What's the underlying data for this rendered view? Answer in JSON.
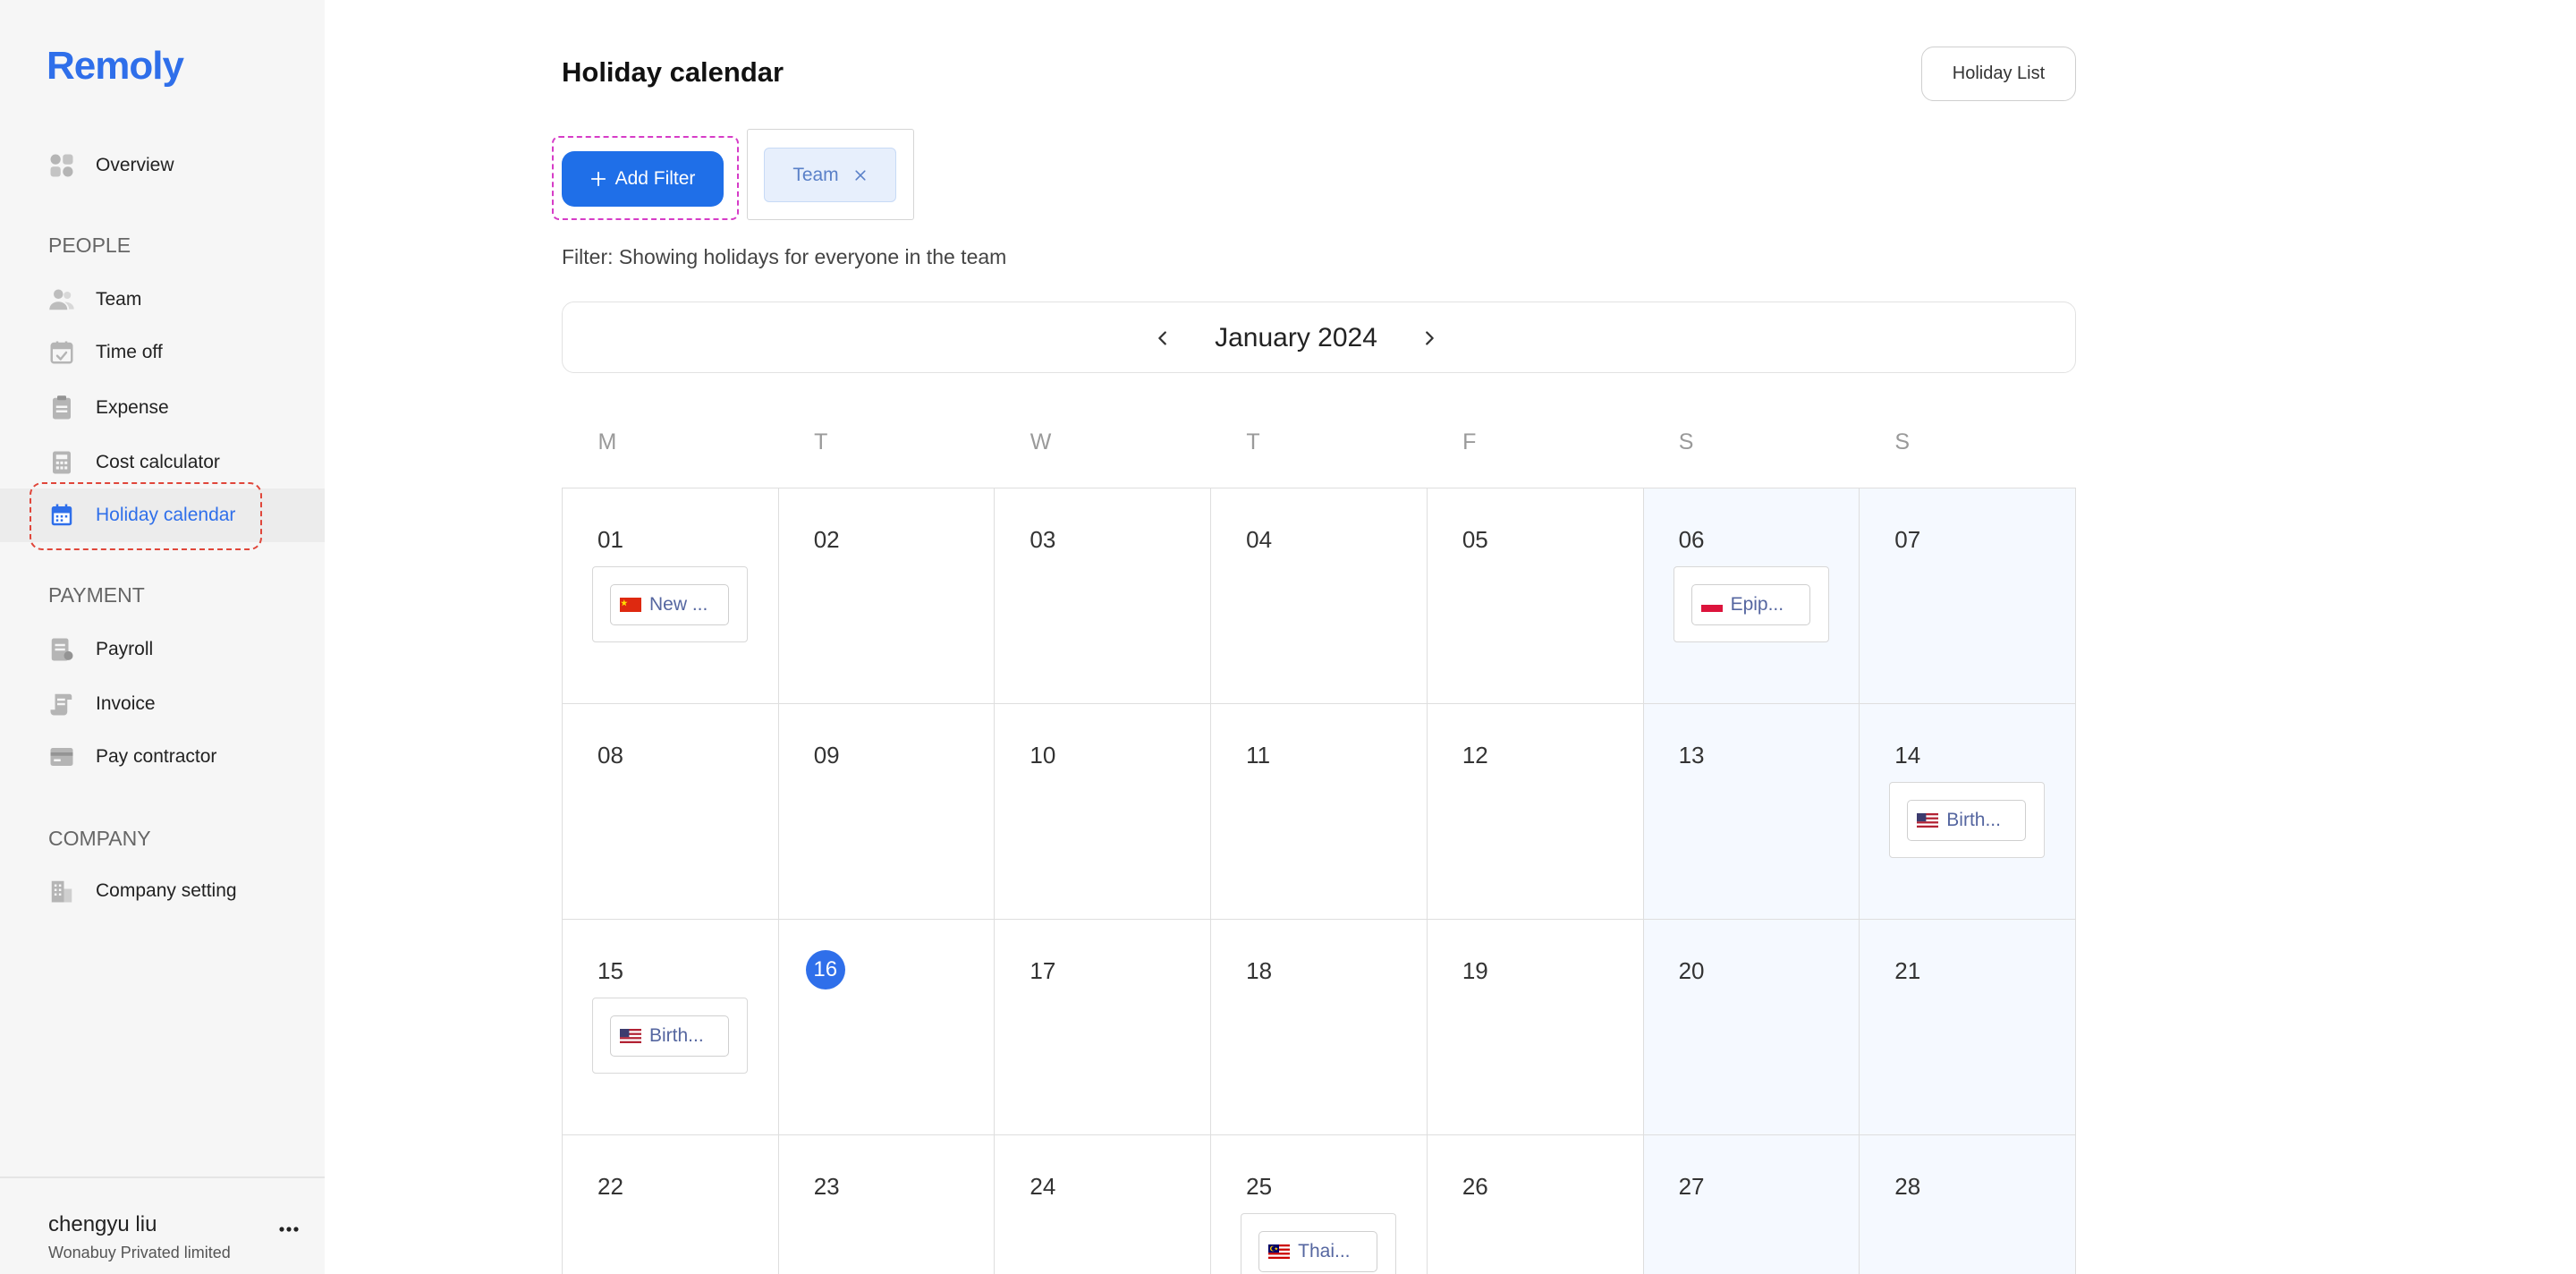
{
  "brand": {
    "logo": "Remoly"
  },
  "colors": {
    "accent": "#2f6fea",
    "sidebar_bg": "#f6f6f6",
    "weekend_bg": "#f5f9ff",
    "annotation_red": "#e0463a",
    "annotation_magenta": "#d63cc7"
  },
  "sidebar": {
    "overview": {
      "label": "Overview",
      "icon": "overview-icon"
    },
    "people": {
      "title": "PEOPLE",
      "items": [
        {
          "label": "Team",
          "icon": "team-icon"
        },
        {
          "label": "Time off",
          "icon": "time-off-icon"
        },
        {
          "label": "Expense",
          "icon": "expense-icon"
        },
        {
          "label": "Cost calculator",
          "icon": "cost-calculator-icon"
        },
        {
          "label": "Holiday calendar",
          "icon": "holiday-calendar-icon",
          "active": true
        }
      ]
    },
    "payment": {
      "title": "PAYMENT",
      "items": [
        {
          "label": "Payroll",
          "icon": "payroll-icon"
        },
        {
          "label": "Invoice",
          "icon": "invoice-icon"
        },
        {
          "label": "Pay contractor",
          "icon": "pay-contractor-icon"
        }
      ]
    },
    "company": {
      "title": "COMPANY",
      "items": [
        {
          "label": "Company setting",
          "icon": "company-setting-icon"
        }
      ]
    },
    "user": {
      "name": "chengyu liu",
      "company": "Wonabuy Privated limited",
      "menu_icon": "more-icon"
    }
  },
  "main": {
    "title": "Holiday calendar",
    "holiday_list_button": "Holiday List",
    "add_filter": {
      "label": "Add Filter",
      "icon": "plus-icon"
    },
    "active_filters": [
      {
        "label": "Team",
        "remove_icon": "close-icon"
      }
    ],
    "filter_text": "Filter: Showing holidays for everyone in the team",
    "calendar": {
      "month_label": "January 2024",
      "prev_icon": "chevron-left-icon",
      "next_icon": "chevron-right-icon",
      "weekdays": [
        "M",
        "T",
        "W",
        "T",
        "F",
        "S",
        "S"
      ],
      "today": "16",
      "weeks": [
        [
          {
            "day": "01",
            "holiday": {
              "flag": "china-flag-icon",
              "label": "New ..."
            }
          },
          {
            "day": "02"
          },
          {
            "day": "03"
          },
          {
            "day": "04"
          },
          {
            "day": "05"
          },
          {
            "day": "06",
            "weekend": true,
            "holiday": {
              "flag": "poland-flag-icon",
              "label": "Epip..."
            }
          },
          {
            "day": "07",
            "weekend": true
          }
        ],
        [
          {
            "day": "08"
          },
          {
            "day": "09"
          },
          {
            "day": "10"
          },
          {
            "day": "11"
          },
          {
            "day": "12"
          },
          {
            "day": "13",
            "weekend": true
          },
          {
            "day": "14",
            "weekend": true,
            "holiday": {
              "flag": "usa-flag-icon",
              "label": "Birth..."
            }
          }
        ],
        [
          {
            "day": "15",
            "holiday": {
              "flag": "usa-flag-icon",
              "label": "Birth..."
            }
          },
          {
            "day": "16"
          },
          {
            "day": "17"
          },
          {
            "day": "18"
          },
          {
            "day": "19"
          },
          {
            "day": "20",
            "weekend": true
          },
          {
            "day": "21",
            "weekend": true
          }
        ],
        [
          {
            "day": "22"
          },
          {
            "day": "23"
          },
          {
            "day": "24"
          },
          {
            "day": "25",
            "holiday": {
              "flag": "malaysia-flag-icon",
              "label": "Thai..."
            }
          },
          {
            "day": "26"
          },
          {
            "day": "27",
            "weekend": true
          },
          {
            "day": "28",
            "weekend": true
          }
        ]
      ]
    }
  }
}
